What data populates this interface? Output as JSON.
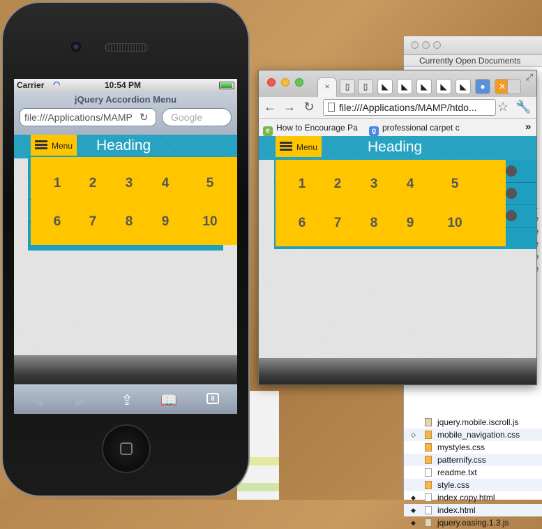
{
  "doc_window": {
    "header": "Currently Open Documents",
    "files": [
      {
        "name": "jquery.mobile.iscroll.js",
        "type": "js",
        "bullet": ""
      },
      {
        "name": "mobile_navigation.css",
        "type": "css",
        "bullet": "◇"
      },
      {
        "name": "mystyles.css",
        "type": "css",
        "bullet": ""
      },
      {
        "name": "patternify.css",
        "type": "css",
        "bullet": ""
      },
      {
        "name": "readme.txt",
        "type": "txt",
        "bullet": ""
      },
      {
        "name": "style.css",
        "type": "css",
        "bullet": ""
      },
      {
        "name": "index copy.html",
        "type": "html",
        "bullet": "◆"
      },
      {
        "name": "index.html",
        "type": "html",
        "bullet": "◆"
      },
      {
        "name": "jquery.easing.1.3.js",
        "type": "js",
        "bullet": "◆"
      }
    ]
  },
  "iphone": {
    "carrier": "Carrier",
    "time": "10:54 PM",
    "page_title": "jQuery Accordion Menu",
    "url": "file:///Applications/MAMP",
    "search_placeholder": "Google",
    "tabs_count": "8"
  },
  "app": {
    "menu_label": "Menu",
    "heading": "Heading",
    "numbers": [
      "1",
      "2",
      "3",
      "4",
      "5",
      "6",
      "7",
      "8",
      "9",
      "10"
    ]
  },
  "chrome": {
    "url": "file:///Applications/MAMP/htdo...",
    "bookmarks": [
      {
        "label": "How to Encourage Pa",
        "icon": "e"
      },
      {
        "label": "professional carpet c",
        "icon": "g"
      }
    ],
    "bookmarks_more": "»"
  },
  "colors": {
    "accent_teal": "#1f9fbf",
    "menu_yellow": "#ffc600"
  }
}
